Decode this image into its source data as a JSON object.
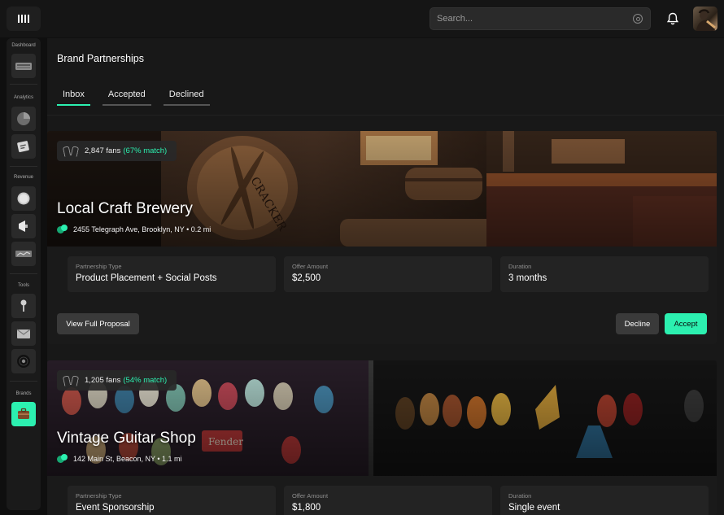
{
  "header": {
    "search_placeholder": "Search...",
    "icons": {
      "logo": "bars-logo-icon",
      "search": "search-icon",
      "notifications": "bell-icon",
      "profile": "user-avatar"
    }
  },
  "sidebar": {
    "sections": [
      {
        "label": "Dashboard",
        "items": [
          {
            "icon": "dashboard-icon"
          }
        ]
      },
      {
        "label": "Analytics",
        "items": [
          {
            "icon": "analytics-icon"
          },
          {
            "icon": "report-icon"
          }
        ]
      },
      {
        "label": "Revenue",
        "items": [
          {
            "icon": "coin-icon"
          },
          {
            "icon": "megaphone-icon"
          },
          {
            "icon": "revenue-chart-icon"
          }
        ]
      },
      {
        "label": "Tools",
        "items": [
          {
            "icon": "microphone-icon"
          },
          {
            "icon": "mail-icon"
          },
          {
            "icon": "vinyl-icon"
          }
        ]
      },
      {
        "label": "Brands",
        "items": [
          {
            "icon": "briefcase-icon",
            "active": true
          }
        ]
      }
    ]
  },
  "page": {
    "title": "Brand Partnerships",
    "tabs": [
      {
        "label": "Inbox",
        "active": true
      },
      {
        "label": "Accepted"
      },
      {
        "label": "Declined"
      }
    ]
  },
  "proposals": [
    {
      "fans": "2,847 fans",
      "match": "(67% match)",
      "name": "Local Craft Brewery",
      "location": "2455 Telegraph Ave, Brooklyn, NY • 0.2 mi",
      "details": [
        {
          "label": "Partnership Type",
          "value": "Product Placement + Social Posts"
        },
        {
          "label": "Offer Amount",
          "value": "$2,500"
        },
        {
          "label": "Duration",
          "value": "3 months"
        }
      ],
      "actions": {
        "view": "View Full Proposal",
        "decline": "Decline",
        "accept": "Accept"
      }
    },
    {
      "fans": "1,205 fans",
      "match": "(54% match)",
      "name": "Vintage Guitar Shop",
      "location": "142 Main St, Beacon, NY • 1.1 mi",
      "details": [
        {
          "label": "Partnership Type",
          "value": "Event Sponsorship"
        },
        {
          "label": "Offer Amount",
          "value": "$1,800"
        },
        {
          "label": "Duration",
          "value": "Single event"
        }
      ]
    }
  ],
  "colors": {
    "accent": "#2cf0b0",
    "background": "#0f0f0f",
    "panel": "#181818",
    "box": "#232323"
  }
}
